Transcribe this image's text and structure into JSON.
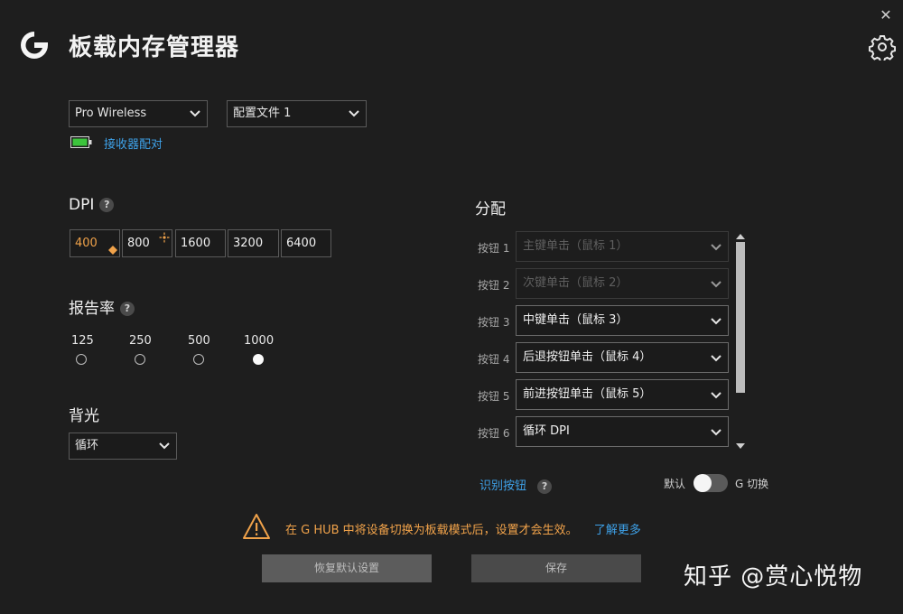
{
  "window": {
    "close_glyph": "✕"
  },
  "header": {
    "title": "板载内存管理器",
    "logo": "logitech-g-logo",
    "settings_icon": "gear-icon"
  },
  "device": {
    "device_select": "Pro Wireless",
    "profile_select": "配置文件 1",
    "battery_icon": "battery-icon",
    "battery_color": "#3cc43c",
    "pair_link": "接收器配对"
  },
  "dpi": {
    "label": "DPI",
    "help": "?",
    "values": [
      "400",
      "800",
      "1600",
      "3200",
      "6400"
    ],
    "active_index": 0,
    "default_marker_color": "#f0a24a"
  },
  "report_rate": {
    "label": "报告率",
    "help": "?",
    "options": [
      "125",
      "250",
      "500",
      "1000"
    ],
    "selected": "1000"
  },
  "backlight": {
    "label": "背光",
    "value": "循环"
  },
  "assignments": {
    "label": "分配",
    "buttons": [
      {
        "label": "按钮 1",
        "value": "主键单击（鼠标 1）",
        "disabled": true
      },
      {
        "label": "按钮 2",
        "value": "次键单击（鼠标 2）",
        "disabled": true
      },
      {
        "label": "按钮 3",
        "value": "中键单击（鼠标 3）",
        "disabled": false
      },
      {
        "label": "按钮 4",
        "value": "后退按钮单击（鼠标 4）",
        "disabled": false
      },
      {
        "label": "按钮 5",
        "value": "前进按钮单击（鼠标 5）",
        "disabled": false
      },
      {
        "label": "按钮 6",
        "value": "循环 DPI",
        "disabled": false
      }
    ],
    "identify_link": "识别按钮",
    "help": "?",
    "toggle_left": "默认",
    "toggle_right": "G 切换",
    "toggle_on": false
  },
  "warning": {
    "text": "在 G HUB 中将设备切换为板载模式后，设置才会生效。",
    "link": "了解更多",
    "color": "#f0a24a"
  },
  "footer": {
    "reset": "恢复默认设置",
    "save": "保存"
  },
  "watermark": "知乎 @赏心悦物",
  "colors": {
    "background": "#1e1e1e",
    "accent_link": "#3ea1e8",
    "warning": "#f0a24a"
  }
}
